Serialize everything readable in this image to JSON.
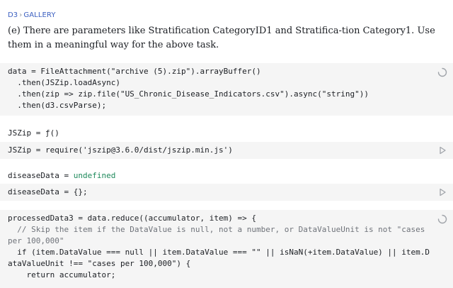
{
  "breadcrumb": {
    "root": "D3",
    "separator": "›",
    "current": "GALLERY"
  },
  "prompt": "(e) There are parameters like Stratification CategoryID1 and Stratifica-tion Category1. Use them in a meaningful way for the above task.",
  "cells": [
    {
      "code_lines": [
        "data = FileAttachment(\"archive (5).zip\").arrayBuffer()",
        "  .then(JSZip.loadAsync)",
        "  .then(zip => zip.file(\"US_Chronic_Disease_Indicators.csv\").async(\"string\"))",
        "  .then(d3.csvParse);"
      ],
      "icon": "spinner-icon"
    },
    {
      "output": "JSZip = ƒ()",
      "code_lines": [
        "JSZip = require('jszip@3.6.0/dist/jszip.min.js')"
      ],
      "icon": "run-icon"
    },
    {
      "output_name": "diseaseData = ",
      "output_value": "undefined",
      "code_lines": [
        "diseaseData = {};"
      ],
      "icon": "run-icon"
    },
    {
      "code_lines": [
        "processedData3 = data.reduce((accumulator, item) => {",
        "  // Skip the item if the DataValue is null, not a number, or DataValueUnit is not \"cases per 100,000\"",
        "  if (item.DataValue === null || item.DataValue === \"\" || isNaN(+item.DataValue) || item.DataValueUnit !== \"cases per 100,000\") {",
        "    return accumulator;"
      ],
      "icon": "spinner-icon"
    }
  ],
  "colors": {
    "link": "#3b5fc0",
    "code_bg": "#f5f5f5",
    "string": "#1b6b3a",
    "identifier": "#2d59d6"
  }
}
